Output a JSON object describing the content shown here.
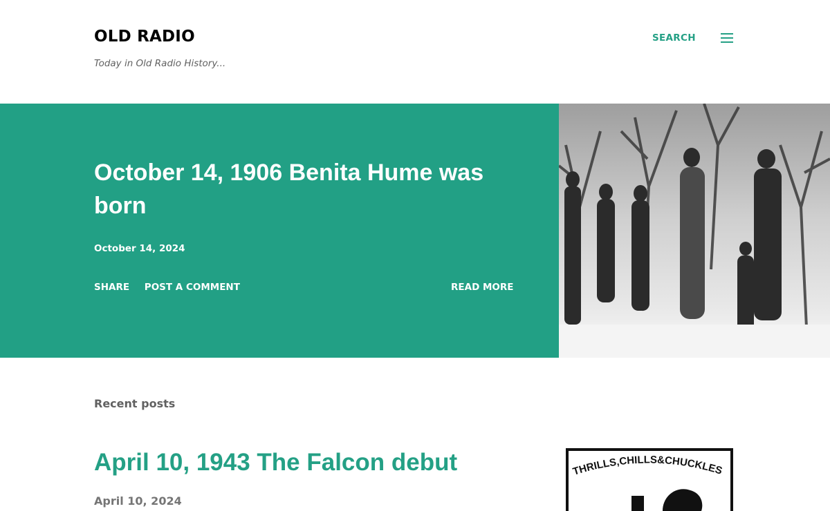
{
  "header": {
    "site_title": "OLD RADIO",
    "tagline": "Today in Old Radio History...",
    "search_label": "SEARCH",
    "menu_icon": "hamburger-menu-icon"
  },
  "hero": {
    "title": "October 14, 1906 Benita Hume was born",
    "date": "October 14, 2024",
    "share_label": "SHARE",
    "comment_label": "POST A COMMENT",
    "read_more_label": "READ MORE",
    "background_color": "#22a085"
  },
  "recent": {
    "section_label": "Recent posts",
    "posts": [
      {
        "title": "April 10, 1943 The Falcon debut",
        "date": "April 10, 2024",
        "thumb_text": "THRILLS,CHILLS&CHUCKLES"
      }
    ]
  },
  "colors": {
    "accent": "#24a085",
    "text_muted": "#616161"
  }
}
